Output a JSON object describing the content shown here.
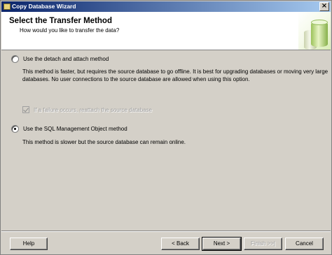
{
  "window": {
    "title": "Copy Database Wizard",
    "close_glyph": "×"
  },
  "header": {
    "title": "Select the Transfer Method",
    "subtitle": "How would you like to transfer the data?"
  },
  "options": {
    "detach": {
      "label": "Use the detach and attach method",
      "selected": false,
      "description_line1": "This method is faster, but requires the source database to go offline. It is best for upgrading databases or moving very large",
      "description_line2": "databases. No user connections to the source database are allowed when using this option.",
      "reattach_label": "If a failure occurs, reattach the source database",
      "reattach_checked": true,
      "reattach_enabled": false
    },
    "smo": {
      "label": "Use the SQL Management Object method",
      "selected": true,
      "description": "This method is slower but the source database can remain online."
    }
  },
  "buttons": {
    "help": "Help",
    "back": "< Back",
    "next": "Next >",
    "finish": "Finish >>|",
    "cancel": "Cancel"
  }
}
